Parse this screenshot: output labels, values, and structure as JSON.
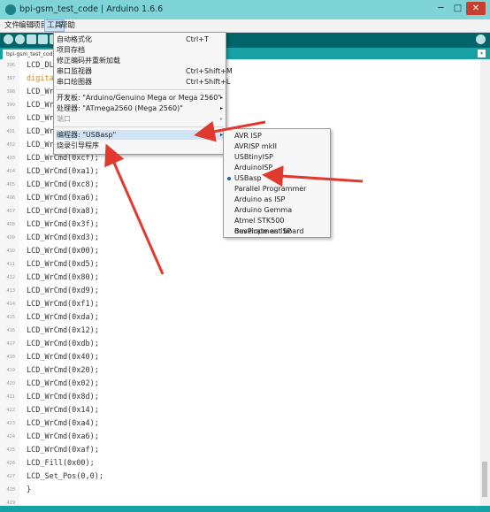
{
  "window": {
    "title": "bpi-gsm_test_code | Arduino 1.6.6",
    "min": "─",
    "max": "□",
    "close": "✕"
  },
  "menubar": [
    "文件",
    "编辑",
    "项目",
    "工具",
    "帮助"
  ],
  "tab": {
    "label": "bpi-gsm_test_code",
    "menu_glyph": "▾"
  },
  "tools_menu": {
    "items": [
      {
        "label": "自动格式化",
        "shortcut": "Ctrl+T"
      },
      {
        "label": "项目存档",
        "shortcut": ""
      },
      {
        "label": "修正编码并重新加载",
        "shortcut": ""
      },
      {
        "label": "串口监视器",
        "shortcut": "Ctrl+Shift+M"
      },
      {
        "label": "串口绘图器",
        "shortcut": "Ctrl+Shift+L"
      },
      {
        "label": "开发板: \"Arduino/Genuino Mega or Mega 2560\"",
        "shortcut": ""
      },
      {
        "label": "处理器: \"ATmega2560 (Mega 2560)\"",
        "shortcut": ""
      },
      {
        "label": "端口",
        "shortcut": ""
      },
      {
        "label": "编程器: \"USBasp\"",
        "shortcut": ""
      },
      {
        "label": "烧录引导程序",
        "shortcut": ""
      }
    ],
    "submenu_arrow": "▸"
  },
  "programmer_submenu": {
    "items": [
      "AVR ISP",
      "AVRISP mkII",
      "USBtinyISP",
      "ArduinoISP",
      "USBasp",
      "Parallel Programmer",
      "Arduino as ISP",
      "Arduino Gemma",
      "Atmel STK500 development board",
      "BusPirate as ISP"
    ],
    "selected": "USBasp"
  },
  "code_lines": [
    {
      "ln": "396",
      "text": "LCD_DL"
    },
    {
      "ln": "397",
      "text": "digita"
    },
    {
      "ln": "398",
      "text": "LCD_Wr"
    },
    {
      "ln": "399",
      "text": "LCD_Wr"
    },
    {
      "ln": "400",
      "text": "LCD_Wr"
    },
    {
      "ln": "401",
      "text": "LCD_Wr"
    },
    {
      "ln": "402",
      "text": "LCD_Wr"
    },
    {
      "ln": "403",
      "text": "LCD_WrCmd(0xcf);"
    },
    {
      "ln": "404",
      "text": "LCD_WrCmd(0xa1);"
    },
    {
      "ln": "405",
      "text": "LCD_WrCmd(0xc8);"
    },
    {
      "ln": "406",
      "text": "LCD_WrCmd(0xa6);"
    },
    {
      "ln": "407",
      "text": "LCD_WrCmd(0xa8);"
    },
    {
      "ln": "408",
      "text": "LCD_WrCmd(0x3f);"
    },
    {
      "ln": "409",
      "text": "LCD_WrCmd(0xd3);"
    },
    {
      "ln": "410",
      "text": "LCD_WrCmd(0x00);"
    },
    {
      "ln": "411",
      "text": "LCD_WrCmd(0xd5);"
    },
    {
      "ln": "412",
      "text": "LCD_WrCmd(0x80);"
    },
    {
      "ln": "413",
      "text": "LCD_WrCmd(0xd9);"
    },
    {
      "ln": "414",
      "text": "LCD_WrCmd(0xf1);"
    },
    {
      "ln": "415",
      "text": "LCD_WrCmd(0xda);"
    },
    {
      "ln": "416",
      "text": "LCD_WrCmd(0x12);"
    },
    {
      "ln": "417",
      "text": "LCD_WrCmd(0xdb);"
    },
    {
      "ln": "418",
      "text": "LCD_WrCmd(0x40);"
    },
    {
      "ln": "419",
      "text": "LCD_WrCmd(0x20);"
    },
    {
      "ln": "420",
      "text": "LCD_WrCmd(0x02);"
    },
    {
      "ln": "421",
      "text": "LCD_WrCmd(0x8d);"
    },
    {
      "ln": "422",
      "text": "LCD_WrCmd(0x14);"
    },
    {
      "ln": "423",
      "text": "LCD_WrCmd(0xa4);"
    },
    {
      "ln": "424",
      "text": "LCD_WrCmd(0xa6);"
    },
    {
      "ln": "425",
      "text": "LCD_WrCmd(0xaf);"
    },
    {
      "ln": "426",
      "text": "LCD_Fill(0x00);"
    },
    {
      "ln": "427",
      "text": "LCD_Set_Pos(0,0);"
    },
    {
      "ln": "428",
      "text": "}"
    },
    {
      "ln": "429",
      "text": ""
    }
  ],
  "colors": {
    "accent": "#006468",
    "tab_row": "#17a1a5",
    "title_bar": "#7fd4d8",
    "annotation": "#e03a2f"
  }
}
